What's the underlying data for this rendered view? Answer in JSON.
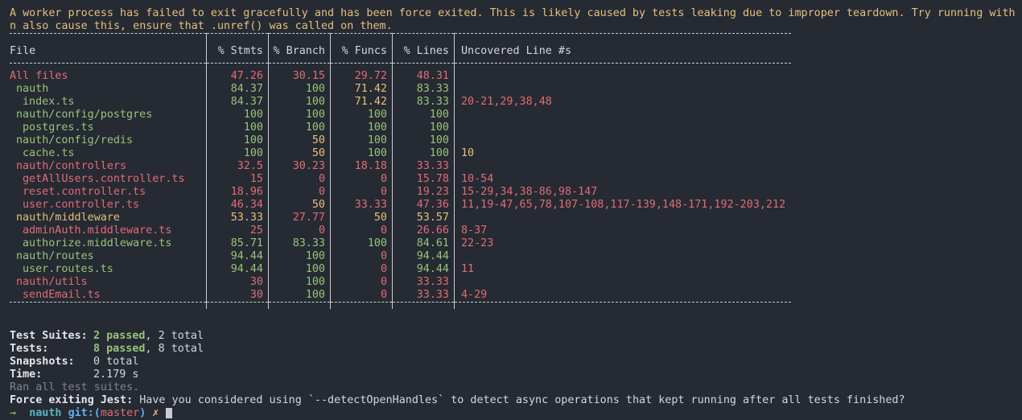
{
  "warning": {
    "line1": "A worker process has failed to exit gracefully and has been force exited. This is likely caused by tests leaking due to improper teardown. Try running with --",
    "line2": "n also cause this, ensure that .unref() was called on them."
  },
  "coverage": {
    "headers": {
      "file": "File",
      "stmts": "% Stmts",
      "branch": "% Branch",
      "funcs": "% Funcs",
      "lines": "% Lines",
      "uncovered": "Uncovered Line #s"
    },
    "rows": [
      {
        "file": "All files",
        "indent": 0,
        "stmts": "47.26",
        "branch": "30.15",
        "funcs": "29.72",
        "lines": "48.31",
        "uncovered": "",
        "colors": [
          "red",
          "red",
          "red",
          "red",
          "red"
        ]
      },
      {
        "file": "nauth",
        "indent": 1,
        "stmts": "84.37",
        "branch": "100",
        "funcs": "71.42",
        "lines": "83.33",
        "uncovered": "",
        "colors": [
          "green",
          "green",
          "green",
          "yellow",
          "green"
        ]
      },
      {
        "file": "index.ts",
        "indent": 2,
        "stmts": "84.37",
        "branch": "100",
        "funcs": "71.42",
        "lines": "83.33",
        "uncovered": "20-21,29,38,48",
        "colors": [
          "green",
          "green",
          "green",
          "yellow",
          "green"
        ]
      },
      {
        "file": "nauth/config/postgres",
        "indent": 1,
        "stmts": "100",
        "branch": "100",
        "funcs": "100",
        "lines": "100",
        "uncovered": "",
        "colors": [
          "green",
          "green",
          "green",
          "green",
          "green"
        ]
      },
      {
        "file": "postgres.ts",
        "indent": 2,
        "stmts": "100",
        "branch": "100",
        "funcs": "100",
        "lines": "100",
        "uncovered": "",
        "colors": [
          "green",
          "green",
          "green",
          "green",
          "green"
        ]
      },
      {
        "file": "nauth/config/redis",
        "indent": 1,
        "stmts": "100",
        "branch": "50",
        "funcs": "100",
        "lines": "100",
        "uncovered": "",
        "colors": [
          "green",
          "green",
          "yellow",
          "green",
          "green"
        ]
      },
      {
        "file": "cache.ts",
        "indent": 2,
        "stmts": "100",
        "branch": "50",
        "funcs": "100",
        "lines": "100",
        "uncovered": "10",
        "colors": [
          "green",
          "green",
          "yellow",
          "green",
          "green"
        ],
        "unc_color": "yellow"
      },
      {
        "file": "nauth/controllers",
        "indent": 1,
        "stmts": "32.5",
        "branch": "30.23",
        "funcs": "18.18",
        "lines": "33.33",
        "uncovered": "",
        "colors": [
          "red",
          "red",
          "red",
          "red",
          "red"
        ]
      },
      {
        "file": "getAllUsers.controller.ts",
        "indent": 2,
        "stmts": "15",
        "branch": "0",
        "funcs": "0",
        "lines": "15.78",
        "uncovered": "10-54",
        "colors": [
          "red",
          "red",
          "red",
          "red",
          "red"
        ]
      },
      {
        "file": "reset.controller.ts",
        "indent": 2,
        "stmts": "18.96",
        "branch": "0",
        "funcs": "0",
        "lines": "19.23",
        "uncovered": "15-29,34,38-86,98-147",
        "colors": [
          "red",
          "red",
          "red",
          "red",
          "red"
        ]
      },
      {
        "file": "user.controller.ts",
        "indent": 2,
        "stmts": "46.34",
        "branch": "50",
        "funcs": "33.33",
        "lines": "47.36",
        "uncovered": "11,19-47,65,78,107-108,117-139,148-171,192-203,212",
        "colors": [
          "red",
          "red",
          "yellow",
          "red",
          "red"
        ]
      },
      {
        "file": "nauth/middleware",
        "indent": 1,
        "stmts": "53.33",
        "branch": "27.77",
        "funcs": "50",
        "lines": "53.57",
        "uncovered": "",
        "colors": [
          "yellow",
          "yellow",
          "red",
          "yellow",
          "yellow"
        ]
      },
      {
        "file": "adminAuth.middleware.ts",
        "indent": 2,
        "stmts": "25",
        "branch": "0",
        "funcs": "0",
        "lines": "26.66",
        "uncovered": "8-37",
        "colors": [
          "red",
          "red",
          "red",
          "red",
          "red"
        ]
      },
      {
        "file": "authorize.middleware.ts",
        "indent": 2,
        "stmts": "85.71",
        "branch": "83.33",
        "funcs": "100",
        "lines": "84.61",
        "uncovered": "22-23",
        "colors": [
          "green",
          "green",
          "green",
          "green",
          "green"
        ]
      },
      {
        "file": "nauth/routes",
        "indent": 1,
        "stmts": "94.44",
        "branch": "100",
        "funcs": "0",
        "lines": "94.44",
        "uncovered": "",
        "colors": [
          "green",
          "green",
          "green",
          "red",
          "green"
        ]
      },
      {
        "file": "user.routes.ts",
        "indent": 2,
        "stmts": "94.44",
        "branch": "100",
        "funcs": "0",
        "lines": "94.44",
        "uncovered": "11",
        "colors": [
          "green",
          "green",
          "green",
          "red",
          "green"
        ]
      },
      {
        "file": "nauth/utils",
        "indent": 1,
        "stmts": "30",
        "branch": "100",
        "funcs": "0",
        "lines": "33.33",
        "uncovered": "",
        "colors": [
          "red",
          "red",
          "green",
          "red",
          "red"
        ]
      },
      {
        "file": "sendEmail.ts",
        "indent": 2,
        "stmts": "30",
        "branch": "100",
        "funcs": "0",
        "lines": "33.33",
        "uncovered": "4-29",
        "colors": [
          "red",
          "red",
          "green",
          "red",
          "red"
        ]
      }
    ]
  },
  "summary": {
    "suites_label": "Test Suites:",
    "suites_passed": "2 passed",
    "suites_total": ", 2 total",
    "tests_label": "Tests:",
    "tests_passed": "8 passed",
    "tests_total": ", 8 total",
    "snapshots_label": "Snapshots:",
    "snapshots_value": "0 total",
    "time_label": "Time:",
    "time_value": "2.179 s",
    "ran_all": "Ran all test suites.",
    "force_label": "Force exiting Jest:",
    "force_text": " Have you considered using `--detectOpenHandles` to detect async operations that kept running after all tests finished?"
  },
  "prompt": {
    "arrow": "→",
    "dir": "nauth",
    "git": "git:(",
    "branch": "master",
    "git_close": ")",
    "dirty": "✗"
  },
  "colors": {
    "background": "#262a33",
    "red": "#e06c75",
    "green": "#98c379",
    "yellow": "#e5c07b"
  }
}
